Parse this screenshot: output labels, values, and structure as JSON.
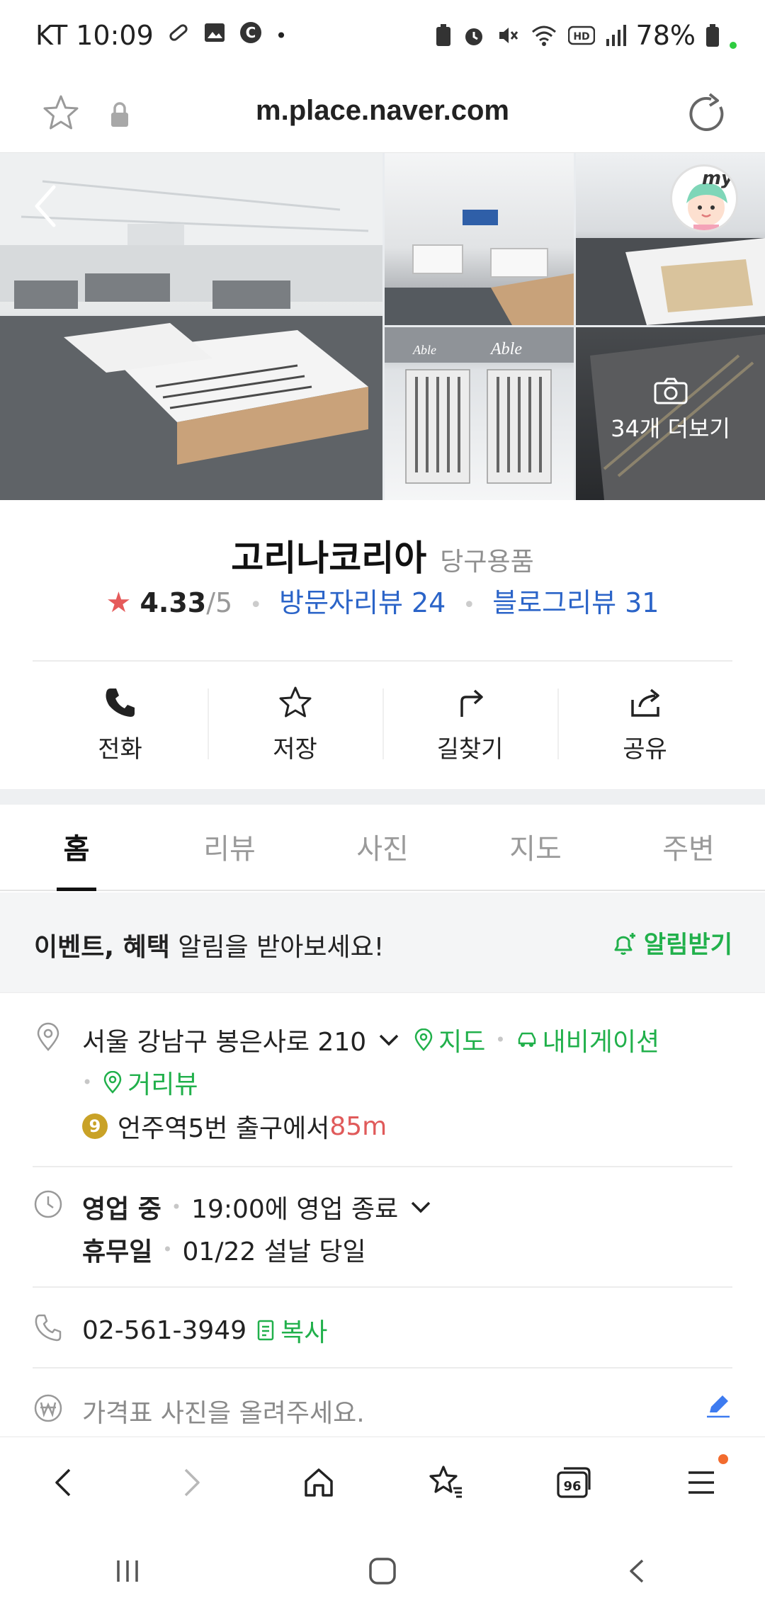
{
  "status_bar": {
    "carrier_time": "KT 10:09",
    "battery": "78%",
    "left_icons": [
      "bandage-icon",
      "image-icon",
      "c-icon",
      "dot-icon"
    ],
    "right_icons": [
      "battery-saver-icon",
      "alarm-icon",
      "mute-icon",
      "wifi-icon",
      "hd-icon",
      "signal-icon",
      "battery-icon"
    ]
  },
  "browser": {
    "url": "m.place.naver.com"
  },
  "gallery": {
    "more_photos": "34개 더보기",
    "my_label": "my"
  },
  "place": {
    "name": "고리나코리아",
    "category": "당구용품",
    "rating": "4.33",
    "rating_max": "/5",
    "visitor_reviews": "방문자리뷰 24",
    "blog_reviews": "블로그리뷰 31"
  },
  "actions": [
    {
      "label": "전화",
      "icon": "phone-icon"
    },
    {
      "label": "저장",
      "icon": "star-icon"
    },
    {
      "label": "길찾기",
      "icon": "directions-icon"
    },
    {
      "label": "공유",
      "icon": "share-icon"
    }
  ],
  "tabs": [
    "홈",
    "리뷰",
    "사진",
    "지도",
    "주변"
  ],
  "active_tab": "홈",
  "notify": {
    "bold1": "이벤트",
    "comma": ", ",
    "bold2": "혜택",
    "rest": " 알림을 받아보세요!",
    "button": "알림받기"
  },
  "address": {
    "text": "서울 강남구 봉은사로 210",
    "map_link": "지도",
    "navi_link": "내비게이션",
    "street_link": "거리뷰",
    "subway_line": "9",
    "subway_station": "언주역",
    "subway_exit": " 5번 출구에서 ",
    "distance": "85m"
  },
  "hours": {
    "status": "영업 중",
    "close_text": "19:00에 영업 종료",
    "holiday_label": "휴무일",
    "holiday_text": "01/22 설날 당일"
  },
  "phone": {
    "number": "02-561-3949",
    "copy": "복사"
  },
  "price": {
    "placeholder": "가격표 사진을 올려주세요."
  },
  "colors": {
    "green": "#21b04b",
    "blue_link": "#2b64c8",
    "red_star": "#e55a5a"
  }
}
